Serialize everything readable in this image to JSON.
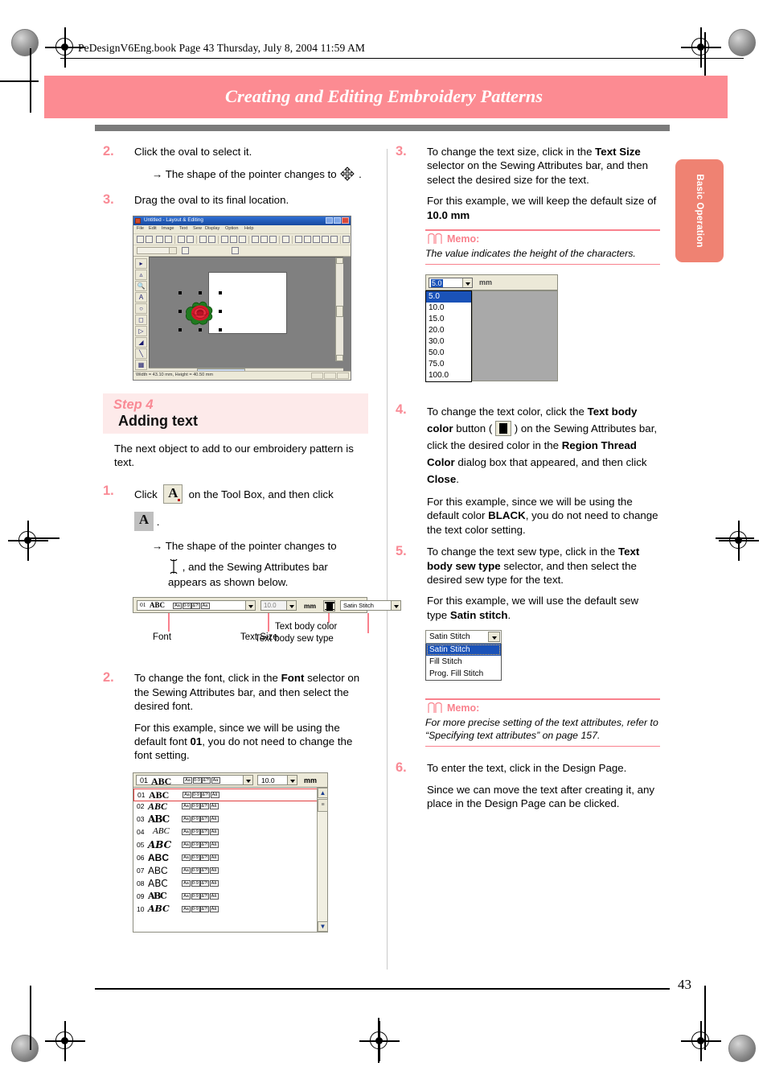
{
  "header": {
    "file_line": "PeDesignV6Eng.book  Page 43  Thursday, July 8, 2004  11:59 AM",
    "chapter_title": "Creating and Editing Embroidery Patterns",
    "side_tab": "Basic Operation",
    "page_number": "43"
  },
  "colors": {
    "accent_pink": "#fc8b92",
    "step_number": "#f98a95",
    "banner_bg": "#fdeaea",
    "side_tab": "#ef8272",
    "rule_gray": "#7b7b7b"
  },
  "left_column": {
    "step2": {
      "number": "2.",
      "line1": "Click the oval to select it.",
      "arrow_pre": "→ The shape of the pointer changes to",
      "arrow_post": "."
    },
    "step3": {
      "number": "3.",
      "line1": "Drag the oval to its final location."
    },
    "app_screenshot": {
      "title": "Untitled - Layout & Editing",
      "menus": [
        "File",
        "Edit",
        "Image",
        "Text",
        "Sew",
        "Display",
        "Option",
        "Help"
      ],
      "combo_value": "(none)",
      "status": "Width = 43.10 mm, Height = 40.50 mm"
    },
    "step_banner": {
      "step_label": "Step 4",
      "title": "Adding text",
      "intro": "The next object to add to our embroidery pattern is text."
    },
    "step1": {
      "number": "1.",
      "pre": "Click",
      "mid": "on the Tool Box, and then click",
      "post": ".",
      "arrow_pre": "→ The shape of the pointer changes to",
      "arrow_post": ", and the Sewing Attributes bar appears as shown below."
    },
    "sewing_bar": {
      "font_index": "01",
      "font_sample": "ABC",
      "glyph_labels": [
        "Aa",
        "0-9",
        "&?!",
        "Aa"
      ],
      "size_value": "10.0",
      "unit": "mm",
      "sew_type": "Satin Stitch",
      "callouts": {
        "font": "Font",
        "text_size": "Text Size",
        "text_body_color": "Text body color",
        "text_body_sew_type": "Text body sew type"
      }
    },
    "step2b": {
      "number": "2.",
      "p1_a": "To change the font, click in the ",
      "p1_b": "Font",
      "p1_c": " selector on the Sewing Attributes bar, and then select the desired font.",
      "p2_a": "For this example, since we will be using the default font ",
      "p2_b": "01",
      "p2_c": ", you do not need to change the font setting."
    },
    "font_dropdown": {
      "current_index": "01",
      "current_sample": "ABC",
      "size_value": "10.0",
      "unit": "mm",
      "rows": [
        {
          "num": "01",
          "sample": "ABC"
        },
        {
          "num": "02",
          "sample": "ABC"
        },
        {
          "num": "03",
          "sample": "ABC"
        },
        {
          "num": "04",
          "sample": "ABC"
        },
        {
          "num": "05",
          "sample": "ABC"
        },
        {
          "num": "06",
          "sample": "ABC"
        },
        {
          "num": "07",
          "sample": "ABC"
        },
        {
          "num": "08",
          "sample": "ABC"
        },
        {
          "num": "09",
          "sample": "ABC"
        },
        {
          "num": "10",
          "sample": "ABC"
        }
      ]
    }
  },
  "right_column": {
    "step3": {
      "number": "3.",
      "p1_a": "To change the text size, click in the ",
      "p1_b": "Text Size",
      "p1_c": " selector on the Sewing Attributes bar, and then select the desired size for the text.",
      "p2_a": "For this example, we will keep the default size of ",
      "p2_b": "10.0 mm"
    },
    "memo1": {
      "label": "Memo:",
      "body": "The value indicates the height of the characters."
    },
    "size_dropdown": {
      "selected": "5.0",
      "unit": "mm",
      "options": [
        "5.0",
        "10.0",
        "15.0",
        "20.0",
        "30.0",
        "50.0",
        "75.0",
        "100.0"
      ]
    },
    "step4": {
      "number": "4.",
      "a": "To change the text color, click the ",
      "b1": "Text body color",
      "c": " button ( ",
      "d": " ) on the Sewing Attributes bar, click the desired color in the ",
      "b2": "Region Thread Color",
      "e": " dialog box that appeared, and then click ",
      "b3": "Close",
      "f": ".",
      "p2_a": "For this example, since we will be using the default color ",
      "p2_b": "BLACK",
      "p2_c": ", you do not need to change the text color setting."
    },
    "step5": {
      "number": "5.",
      "a": "To change the text sew type, click in the ",
      "b1": "Text body sew type",
      "c": " selector, and then select the desired sew type for the text.",
      "p2_a": "For this example, we will use the default sew type ",
      "p2_b": "Satin stitch",
      "p2_c": "."
    },
    "sew_dropdown": {
      "selected": "Satin Stitch",
      "options": [
        "Satin Stitch",
        "Fill Stitch",
        "Prog. Fill Stitch"
      ]
    },
    "memo2": {
      "label": "Memo:",
      "body": "For more precise setting of the text attributes, refer to “Specifying text attributes” on page 157."
    },
    "step6": {
      "number": "6.",
      "p1": "To enter the text, click in the Design Page.",
      "p2": "Since we can move the text after creating it, any place in the Design Page can be clicked."
    }
  }
}
